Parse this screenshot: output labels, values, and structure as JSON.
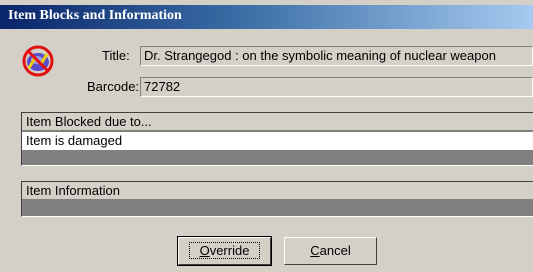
{
  "window": {
    "title": "Item Blocks and Information"
  },
  "icon": {
    "name": "blocked-item-icon",
    "colors": {
      "ring": "#e01010",
      "disc": "#5a4ec8",
      "accent": "#f0d000"
    }
  },
  "item": {
    "title_label": "Title:",
    "title_value": "Dr. Strangegod : on the symbolic meaning of nuclear weapon",
    "barcode_label": "Barcode:",
    "barcode_value": "72782"
  },
  "blocks_panel": {
    "header": "Item Blocked due to...",
    "rows": [
      "Item is damaged"
    ]
  },
  "info_panel": {
    "header": "Item Information"
  },
  "buttons": {
    "override": {
      "mnemonic": "O",
      "rest": "verride"
    },
    "cancel": {
      "mnemonic": "C",
      "rest": "ancel"
    }
  }
}
